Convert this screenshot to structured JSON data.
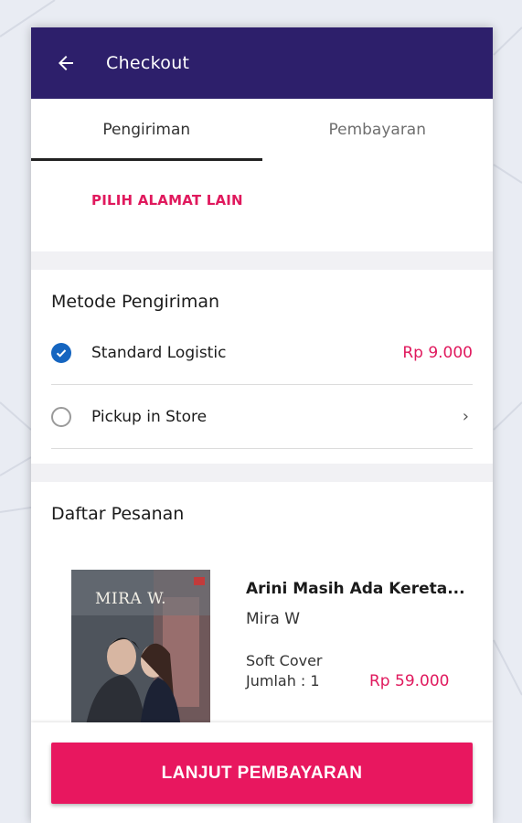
{
  "appbar": {
    "title": "Checkout",
    "back_icon": "arrow-left-icon"
  },
  "tabs": [
    {
      "label": "Pengiriman",
      "active": true
    },
    {
      "label": "Pembayaran",
      "active": false
    }
  ],
  "address": {
    "change_link": "PILIH ALAMAT LAIN"
  },
  "shipping": {
    "title": "Metode Pengiriman",
    "options": [
      {
        "label": "Standard Logistic",
        "price": "Rp 9.000",
        "selected": true
      },
      {
        "label": "Pickup in Store",
        "selected": false
      }
    ]
  },
  "orders": {
    "title": "Daftar Pesanan",
    "items": [
      {
        "cover_text": "MIRA W.",
        "title": "Arini Masih Ada Kereta...",
        "author": "Mira W",
        "format": "Soft Cover",
        "quantity": "Jumlah : 1",
        "price": "Rp 59.000"
      }
    ]
  },
  "cta": {
    "label": "LANJUT PEMBAYARAN"
  },
  "colors": {
    "appbar": "#2d1f6b",
    "accent": "#e8175f",
    "price": "#e0195d",
    "check": "#1565c0"
  }
}
